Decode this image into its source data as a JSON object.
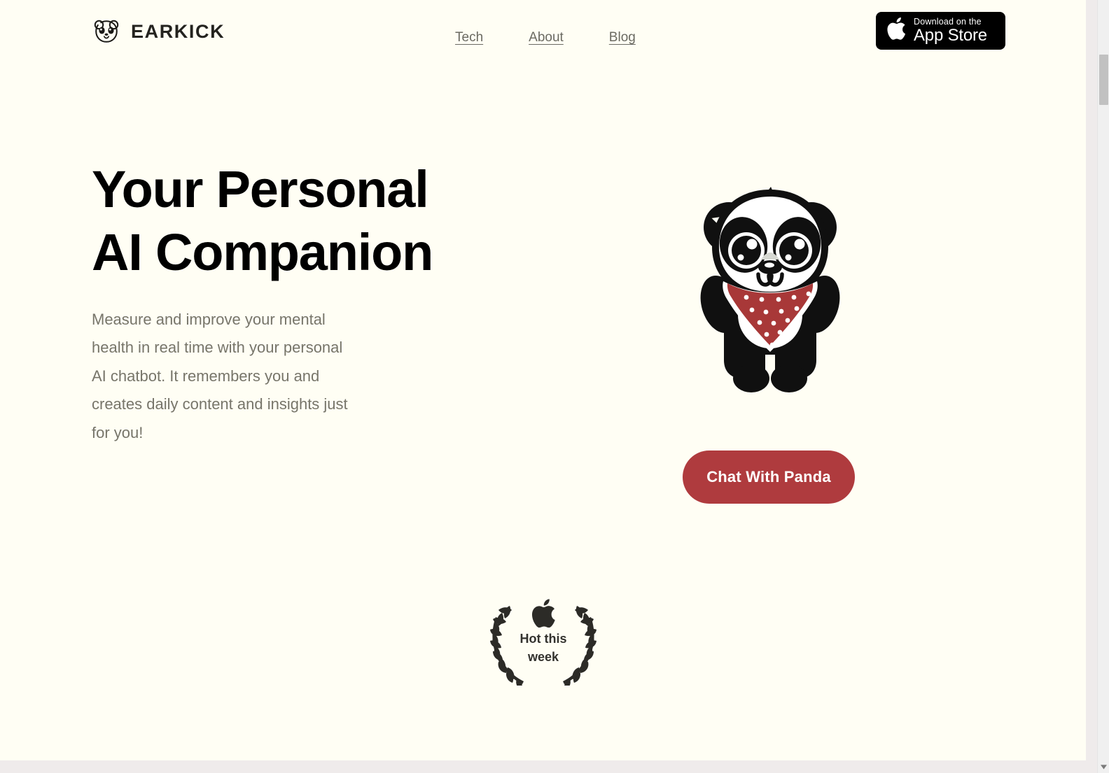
{
  "header": {
    "brand": {
      "name": "EARKICK",
      "icon": "panda-head-icon"
    },
    "nav": [
      {
        "label": "Tech"
      },
      {
        "label": "About"
      },
      {
        "label": "Blog"
      }
    ],
    "appstore": {
      "icon": "apple-logo-icon",
      "small_label": "Download on the",
      "big_label": "App Store"
    }
  },
  "hero": {
    "title": "Your Personal AI Companion",
    "subtitle": "Measure and improve your mental health in real time with your personal AI chatbot. It remembers you and creates daily content and insights just for you!",
    "mascot_icon": "panda-mascot-illustration",
    "cta_label": "Chat With Panda"
  },
  "award": {
    "icon": "apple-logo-icon",
    "wreath_icon": "laurel-wreath-icon",
    "line1": "Hot this",
    "line2": "week"
  },
  "colors": {
    "page_background": "#fffef4",
    "accent_red": "#af3b3e",
    "bandana_red": "#a83838",
    "text_dark": "#000000",
    "text_muted": "#77756a",
    "nav_link": "#6b6a62",
    "badge_black": "#000000",
    "bottom_strip": "#efebeb",
    "scrollbar_track": "#f0f0f0",
    "scrollbar_thumb": "#c1c1c1"
  }
}
